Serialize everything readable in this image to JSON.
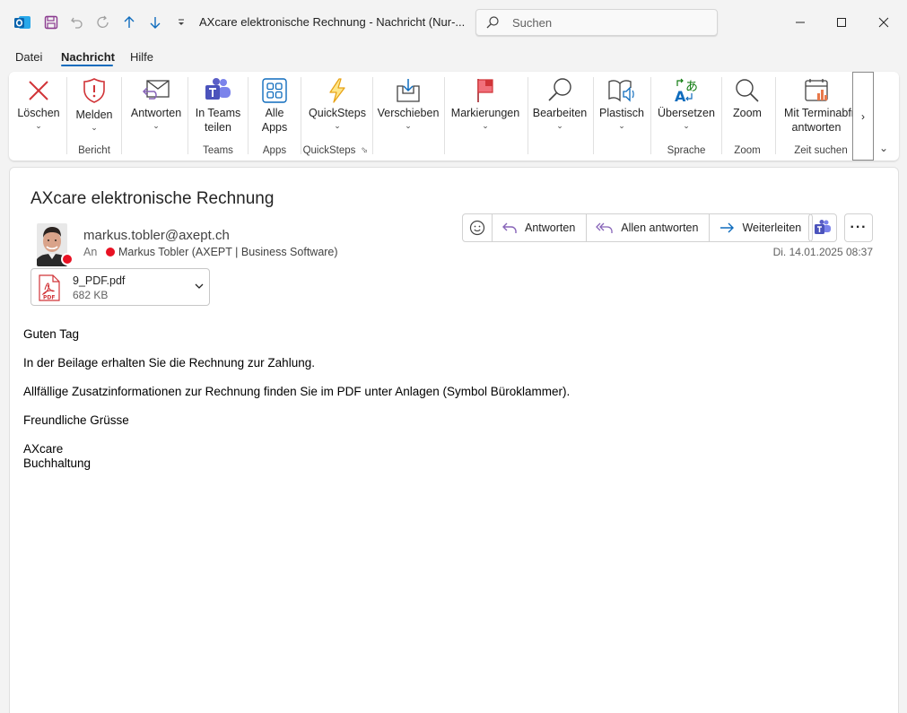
{
  "window": {
    "title": "AXcare elektronische Rechnung  -  Nachricht (Nur-...",
    "search_placeholder": "Suchen"
  },
  "menu": {
    "items": [
      {
        "label": "Datei"
      },
      {
        "label": "Nachricht",
        "active": true
      },
      {
        "label": "Hilfe"
      }
    ]
  },
  "ribbon": {
    "buttons": {
      "delete": "Löschen",
      "report": "Melden",
      "reply": "Antworten",
      "teams_share_1": "In Teams",
      "teams_share_2": "teilen",
      "apps_1": "Alle",
      "apps_2": "Apps",
      "quicksteps": "QuickSteps",
      "move": "Verschieben",
      "tags": "Markierungen",
      "edit": "Bearbeiten",
      "immersive": "Plastisch",
      "translate": "Übersetzen",
      "zoom": "Zoom",
      "schedule_1": "Mit Terminabfr",
      "schedule_2": "antworten"
    },
    "groups": {
      "report": "Bericht",
      "teams": "Teams",
      "apps": "Apps",
      "quicksteps": "QuickSteps",
      "language": "Sprache",
      "zoom": "Zoom",
      "find_time": "Zeit suchen"
    }
  },
  "message": {
    "subject": "AXcare elektronische Rechnung",
    "sender": "markus.tobler@axept.ch",
    "to_label": "An",
    "to_name": "Markus Tobler (AXEPT | Business Software)",
    "timestamp": "Di. 14.01.2025 08:37",
    "actions": {
      "reply": "Antworten",
      "reply_all": "Allen antworten",
      "forward": "Weiterleiten"
    },
    "attachment": {
      "name": "9_PDF.pdf",
      "size": "682 KB",
      "icon_text": "PDF"
    },
    "body": {
      "greeting": "Guten Tag",
      "line1": "In der Beilage erhalten Sie die Rechnung zur Zahlung.",
      "line2": "Allfällige Zusatzinformationen zur Rechnung finden Sie im PDF unter Anlagen (Symbol Büroklammer).",
      "closing": "Freundliche Grüsse",
      "sig1": "AXcare",
      "sig2": "Buchhaltung"
    }
  },
  "colors": {
    "accent": "#0f6cbd",
    "delete_red": "#d13438",
    "presence_busy": "#e81123",
    "teams_purple": "#5b5fc7",
    "reply_purple": "#8764b8"
  }
}
